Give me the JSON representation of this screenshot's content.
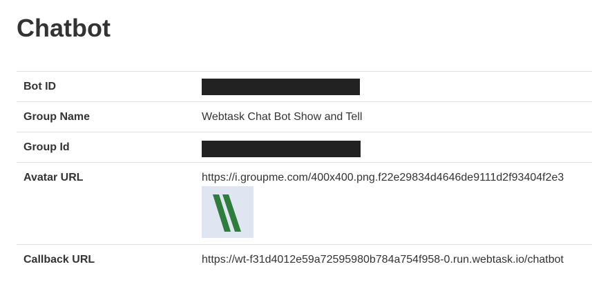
{
  "page": {
    "title": "Chatbot"
  },
  "details": {
    "rows": [
      {
        "label": "Bot ID",
        "value": "",
        "redacted": true
      },
      {
        "label": "Group Name",
        "value": "Webtask Chat Bot Show and Tell"
      },
      {
        "label": "Group Id",
        "value": "",
        "redacted": true
      },
      {
        "label": "Avatar URL",
        "value": "https://i.groupme.com/400x400.png.f22e29834d4646de9111d2f93404f2e3"
      },
      {
        "label": "Callback URL",
        "value": "https://wt-f31d4012e59a72595980b784a754f958-0.run.webtask.io/chatbot"
      }
    ]
  },
  "colors": {
    "text": "#333333",
    "border": "#dddddd",
    "redaction": "#222222",
    "avatar_bg": "#dfe5f1",
    "avatar_stripes": "#2e7d3c"
  },
  "icons": {
    "avatar": "double-slash-logo"
  }
}
